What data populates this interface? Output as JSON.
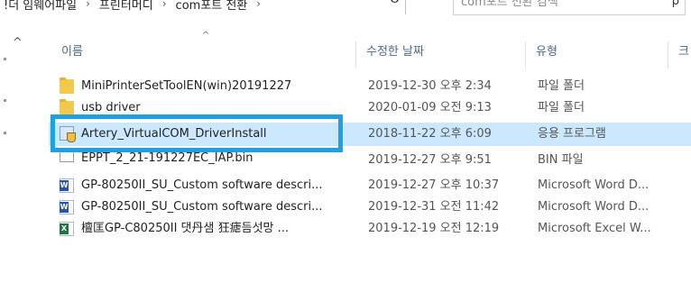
{
  "address_bar": {
    "crumbs": [
      "!더 임웨어파일",
      "프린터머디",
      "com포트 전환"
    ],
    "dropdown_glyph": "v",
    "refresh_glyph": "O"
  },
  "search": {
    "placeholder": "com포트 전환 검색",
    "icon": "search-icon"
  },
  "columns": {
    "name": "이름",
    "date": "수정한 날짜",
    "type": "유형",
    "extra": "크"
  },
  "files": [
    {
      "name": "MiniPrinterSetToolEN(win)20191227",
      "date": "2019-12-30 오후 2:34",
      "type": "파일 폴더",
      "icon": "folder-icon"
    },
    {
      "name": "usb driver",
      "date": "2020-01-09 오전 9:13",
      "type": "파일 폴더",
      "icon": "folder-icon"
    },
    {
      "name": "Artery_VirtualCOM_DriverInstall",
      "date": "2018-11-22 오후 6:09",
      "type": "응용 프로그램",
      "icon": "installer-icon",
      "selected": true
    },
    {
      "name": "EPPT_2_21-191227EC_IAP.bin",
      "date": "2019-12-27 오후 9:51",
      "type": "BIN 파일",
      "icon": "file-icon"
    },
    {
      "name": "GP-80250II_SU_Custom software descri...",
      "date": "2019-12-27 오후 10:37",
      "type": "Microsoft Word D...",
      "icon": "word-document-icon"
    },
    {
      "name": "GP-80250II_SU_Custom software descri...",
      "date": "2019-12-31 오전 11:42",
      "type": "Microsoft Word D...",
      "icon": "word-document-icon"
    },
    {
      "name": "檀匡GP-C80250II 댓丹샘 狂瘧듬섯망  ...",
      "date": "2019-12-19 오전 12:19",
      "type": "Microsoft Excel W...",
      "icon": "excel-document-icon"
    }
  ],
  "colors": {
    "selection": "#cce8ff",
    "highlight_border": "#1fa0e0",
    "folder": "#f2c94c"
  }
}
